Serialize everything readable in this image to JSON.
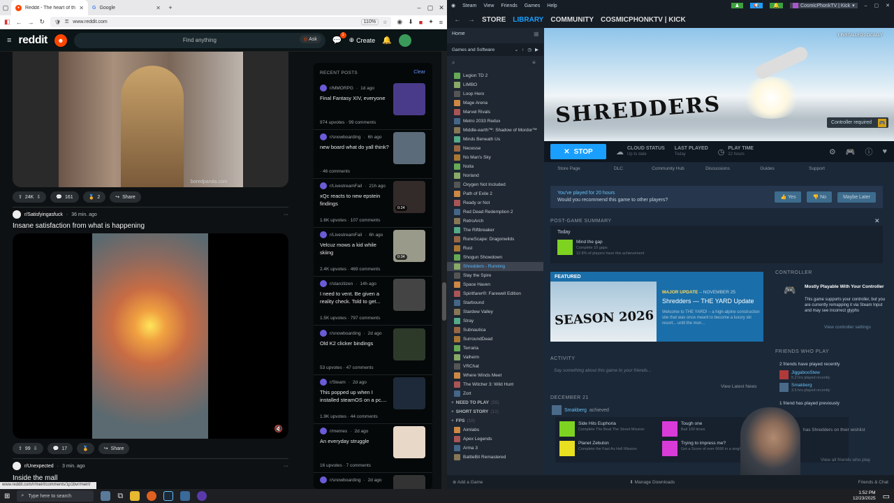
{
  "browser": {
    "tabs": [
      {
        "label": "Reddit - The heart of the intern"
      },
      {
        "label": "Google"
      }
    ],
    "url": "www.reddit.com",
    "zoom": "110%",
    "status_url": "www.reddit.com/r/meirl/comments/1p1bvr/meirl/"
  },
  "reddit": {
    "logo": "reddit",
    "search_placeholder": "Find anything",
    "ask_label": "Ask",
    "create_label": "Create",
    "chat_badge": "1",
    "post1": {
      "upvotes": "24K",
      "comments": "161",
      "awards": "2",
      "share": "Share",
      "watermark": "boredpanda.com"
    },
    "post2": {
      "subreddit": "r/Satisfyingasfuck",
      "time": "36 min. ago",
      "title": "Insane satisfaction from what is happening",
      "upvotes": "99",
      "comments": "17",
      "share": "Share"
    },
    "post3": {
      "subreddit": "r/Unexpected",
      "time": "3 min. ago",
      "title": "Inside the mall"
    },
    "recent": {
      "header": "RECENT POSTS",
      "clear": "Clear",
      "items": [
        {
          "sub": "r/MMORPG",
          "time": "1d ago",
          "title": "Final Fantasy XIV, everyone",
          "upvotes": "974 upvotes",
          "comments": "99 comments",
          "color": "#4a3b8a"
        },
        {
          "sub": "r/snowboarding",
          "time": "6h ago",
          "title": "new board what do yall think?",
          "upvotes": "",
          "comments": "46 comments",
          "color": "#5b6b7a"
        },
        {
          "sub": "r/LivestreamFail",
          "time": "21h ago",
          "title": "xQc reacts to new epstein findings",
          "upvotes": "1.6K upvotes",
          "comments": "107 comments",
          "color": "#332a2a",
          "duration": "0:24"
        },
        {
          "sub": "r/LivestreamFail",
          "time": "6h ago",
          "title": "Velcuz mows a kid while skiing",
          "upvotes": "2.4K upvotes",
          "comments": "469 comments",
          "color": "#9a9a8a",
          "duration": "0:34"
        },
        {
          "sub": "r/starcitizen",
          "time": "14h ago",
          "title": "I need to vent. Be given a reality check. Told to get...",
          "upvotes": "1.5K upvotes",
          "comments": "797 comments",
          "color": "#444"
        },
        {
          "sub": "r/snowboarding",
          "time": "2d ago",
          "title": "Old K2 clicker bindings",
          "upvotes": "53 upvotes",
          "comments": "47 comments",
          "color": "#2d3a2a"
        },
        {
          "sub": "r/Steam",
          "time": "2d ago",
          "title": "This popped up when I installed steamOS on a pc....",
          "upvotes": "1.9K upvotes",
          "comments": "44 comments",
          "color": "#1e2a3a"
        },
        {
          "sub": "r/memes",
          "time": "2d ago",
          "title": "An everyday struggle",
          "upvotes": "16 upvotes",
          "comments": "7 comments",
          "color": "#e8d8c8"
        },
        {
          "sub": "r/snowboarding",
          "time": "2d ago",
          "title": "",
          "upvotes": "",
          "comments": "",
          "color": "#333"
        }
      ]
    }
  },
  "steam": {
    "menu": [
      "Steam",
      "View",
      "Friends",
      "Games",
      "Help"
    ],
    "nav": {
      "store": "STORE",
      "library": "LIBRARY",
      "community": "COMMUNITY",
      "user": "COSMICPHONKTV | KICK"
    },
    "account": "CosmicPhonkTV | Kick",
    "home": "Home",
    "filter": "Games and Software",
    "games": [
      "Legion TD 2",
      "LIMBO",
      "Loop Hero",
      "Mage Arena",
      "Marvel Rivals",
      "Metro 2033 Redux",
      "Middle-earth™: Shadow of Mordor™",
      "Minds Beneath Us",
      "Necesse",
      "No Man's Sky",
      "Noita",
      "Norland",
      "Oxygen Not Included",
      "Path of Exile 2",
      "Ready or Not",
      "Red Dead Redemption 2",
      "RetroArch",
      "The Riftbreaker",
      "RuneScape: Dragonwilds",
      "Rust",
      "Shogun Showdown",
      "Shredders - Running",
      "Slay the Spire",
      "Space Haven",
      "Spiritfarer®: Farewell Edition",
      "Starbound",
      "Stardew Valley",
      "Stray",
      "Subnautica",
      "SurroundDead",
      "Terraria",
      "Valheim",
      "VRChat",
      "Where Winds Meet",
      "The Witcher 3: Wild Hunt",
      "Zort"
    ],
    "categories": [
      {
        "name": "NEED TO PLAY",
        "count": "(55)"
      },
      {
        "name": "SHORT STORY",
        "count": "(12)"
      },
      {
        "name": "FPS",
        "count": "(18)"
      }
    ],
    "fps_games": [
      "Aimlabs",
      "Apex Legends",
      "Arma 3",
      "BattleBit Remastered"
    ],
    "hero": {
      "logo": "SHREDDERS",
      "installed": "1 INSTALLED LOCALLY",
      "controller": "Controller required"
    },
    "bar": {
      "stop": "STOP",
      "cloud_label": "CLOUD STATUS",
      "cloud_value": "Up to date",
      "last_label": "LAST PLAYED",
      "last_value": "Today",
      "time_label": "PLAY TIME",
      "time_value": "22 hours"
    },
    "tabs": [
      "Store Page",
      "DLC",
      "Community Hub",
      "Discussions",
      "Guides",
      "Support"
    ],
    "review": {
      "played": "You've played for 20 hours",
      "question": "Would you recommend this game to other players?",
      "yes": "Yes",
      "no": "No",
      "later": "Maybe Later"
    },
    "postgame": {
      "header": "POST-GAME SUMMARY",
      "day": "Today",
      "ach_name": "Mind the gap",
      "ach_desc": "Complete 10 gaps",
      "ach_pct": "12.8% of players have this achievement"
    },
    "featured": {
      "label": "FEATURED",
      "art": "SEASON 2026",
      "kind": "MAJOR UPDATE",
      "date": "NOVEMBER 25",
      "title": "Shredders — THE YARD Update",
      "desc": "Welcome to THE YARD! – a high-alpine construction site that was once meant to become a luxury ski resort... until the mon..."
    },
    "controller": {
      "header": "CONTROLLER",
      "title": "Mostly Playable With Your Controller",
      "desc": "This game supports your controller, but you are currently remapping it via Steam Input and may see incorrect glyphs",
      "link": "View controller settings"
    },
    "activity": {
      "header": "ACTIVITY",
      "placeholder": "Say something about this game to your friends...",
      "news": "View Latest News",
      "date": "DECEMBER 21",
      "user": "Smakberg",
      "verb": "achieved",
      "achievements": [
        {
          "name": "Side Hits Euphoria",
          "desc": "Complete The Beat The Street Mission"
        },
        {
          "name": "Tough one",
          "desc": "Bail 100 times"
        },
        {
          "name": "Planet Zebulon",
          "desc": "Complete the Fast As Hell Mission"
        },
        {
          "name": "Trying to impress me?",
          "desc": "Get a Score of over 6666 in a single trick"
        }
      ]
    },
    "friends": {
      "header": "FRIENDS WHO PLAY",
      "recent": "2 friends have played recently",
      "list": [
        {
          "name": "JiggabooStew",
          "time": "5.2 hrs played recently"
        },
        {
          "name": "Smakberg",
          "time": "3.5 hrs played recently"
        }
      ],
      "previous": "1 friend has played previously",
      "wishlist": "has Shredders on their wishlist",
      "all": "View all friends who play"
    },
    "bottom": {
      "add": "Add a Game",
      "downloads": "Manage Downloads",
      "chat": "Friends & Chat"
    }
  },
  "taskbar": {
    "search": "Type here to search",
    "time": "1:52 PM",
    "date": "12/23/2025"
  }
}
